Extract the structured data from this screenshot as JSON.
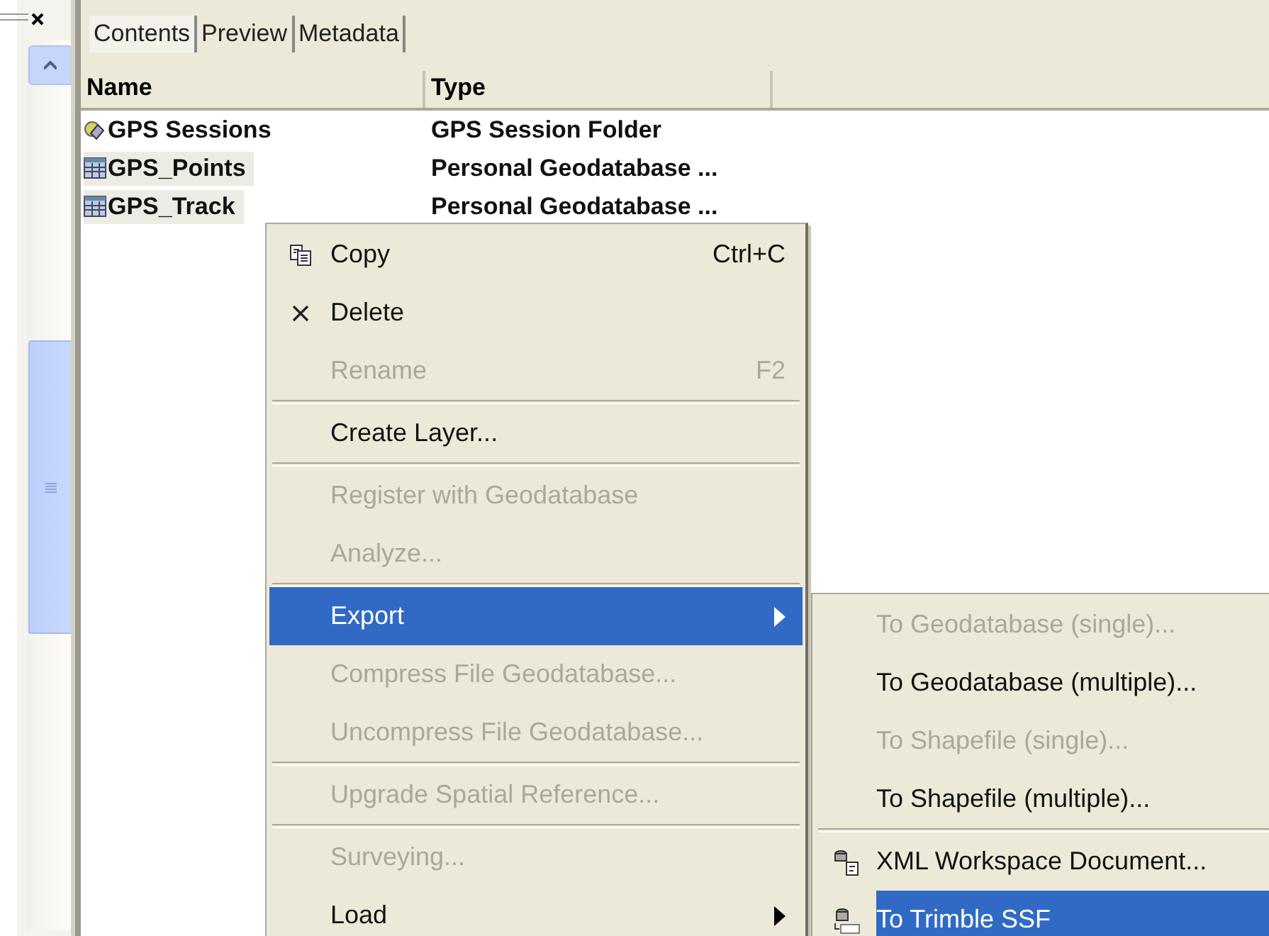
{
  "tabs": [
    {
      "label": "Contents",
      "selected": true
    },
    {
      "label": "Preview",
      "selected": false
    },
    {
      "label": "Metadata",
      "selected": false
    }
  ],
  "table": {
    "columns": [
      "Name",
      "Type"
    ],
    "rows": [
      {
        "name": "GPS Sessions",
        "type": "GPS Session Folder",
        "selected": false
      },
      {
        "name": "GPS_Points",
        "type": "Personal Geodatabase ...",
        "selected": true
      },
      {
        "name": "GPS_Track",
        "type": "Personal Geodatabase ...",
        "selected": true
      }
    ]
  },
  "context_menu": {
    "items": [
      {
        "kind": "item",
        "label": "Copy",
        "shortcut": "Ctrl+C",
        "disabled": false,
        "selected": false,
        "submenu": false
      },
      {
        "kind": "item",
        "label": "Delete",
        "disabled": false,
        "selected": false,
        "submenu": false
      },
      {
        "kind": "item",
        "label": "Rename",
        "shortcut": "F2",
        "disabled": true,
        "selected": false,
        "submenu": false
      },
      {
        "kind": "separator"
      },
      {
        "kind": "item",
        "label": "Create Layer...",
        "disabled": false,
        "selected": false,
        "submenu": false
      },
      {
        "kind": "separator"
      },
      {
        "kind": "item",
        "label": "Register with Geodatabase",
        "disabled": true,
        "selected": false,
        "submenu": false
      },
      {
        "kind": "item",
        "label": "Analyze...",
        "disabled": true,
        "selected": false,
        "submenu": false
      },
      {
        "kind": "separator"
      },
      {
        "kind": "item",
        "label": "Export",
        "disabled": false,
        "selected": true,
        "submenu": true
      },
      {
        "kind": "item",
        "label": "Compress File Geodatabase...",
        "disabled": true,
        "selected": false,
        "submenu": false
      },
      {
        "kind": "item",
        "label": "Uncompress File Geodatabase...",
        "disabled": true,
        "selected": false,
        "submenu": false
      },
      {
        "kind": "separator"
      },
      {
        "kind": "item",
        "label": "Upgrade Spatial Reference...",
        "disabled": true,
        "selected": false,
        "submenu": false
      },
      {
        "kind": "separator"
      },
      {
        "kind": "item",
        "label": "Surveying...",
        "disabled": true,
        "selected": false,
        "submenu": false
      },
      {
        "kind": "item",
        "label": "Load",
        "disabled": false,
        "selected": false,
        "submenu": true
      }
    ]
  },
  "export_submenu": {
    "items": [
      {
        "kind": "item",
        "label": "To Geodatabase (single)...",
        "disabled": true,
        "selected": false,
        "submenu": false
      },
      {
        "kind": "item",
        "label": "To Geodatabase (multiple)...",
        "disabled": false,
        "selected": false,
        "submenu": false
      },
      {
        "kind": "item",
        "label": "To Shapefile (single)...",
        "disabled": true,
        "selected": false,
        "submenu": false
      },
      {
        "kind": "item",
        "label": "To Shapefile (multiple)...",
        "disabled": false,
        "selected": false,
        "submenu": false
      },
      {
        "kind": "separator"
      },
      {
        "kind": "item",
        "label": "XML Workspace Document...",
        "disabled": false,
        "selected": false,
        "submenu": false
      },
      {
        "kind": "item",
        "label": "To Trimble SSF",
        "disabled": false,
        "selected": true,
        "submenu": false
      }
    ]
  }
}
